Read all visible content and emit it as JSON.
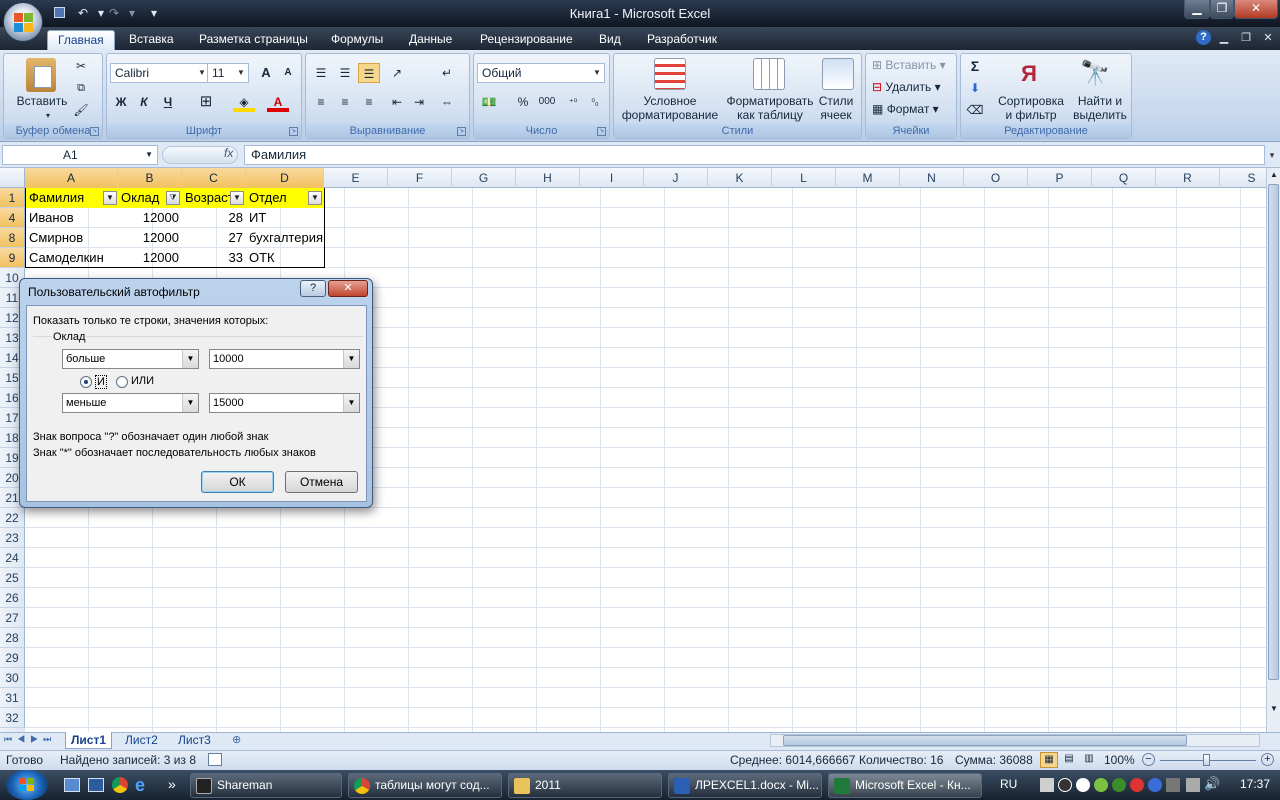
{
  "window": {
    "title": "Книга1 - Microsoft Excel",
    "minimize": "▁",
    "restore": "❐",
    "close": "✕"
  },
  "quick_access": {
    "save": "save-icon",
    "undo": "↶",
    "redo": "↷",
    "more": "▾"
  },
  "ribbon_tabs": [
    "Главная",
    "Вставка",
    "Разметка страницы",
    "Формулы",
    "Данные",
    "Рецензирование",
    "Вид",
    "Разработчик"
  ],
  "ribbon": {
    "clipboard": {
      "label": "Буфер обмена",
      "paste": "Вставить"
    },
    "font": {
      "label": "Шрифт",
      "name": "Calibri",
      "size": "11",
      "bold": "Ж",
      "italic": "К",
      "underline": "Ч",
      "grow": "A",
      "shrink": "A",
      "fontcolor": "A"
    },
    "alignment": {
      "label": "Выравнивание"
    },
    "number": {
      "label": "Число",
      "format": "Общий",
      "percent": "%",
      "thousands": "000"
    },
    "styles": {
      "label": "Стили",
      "cond": "Условное форматирование",
      "astable": "Форматировать как таблицу",
      "cellstyles": "Стили ячеек"
    },
    "cells": {
      "label": "Ячейки",
      "insert": "Вставить",
      "delete": "Удалить",
      "format": "Формат"
    },
    "editing": {
      "label": "Редактирование",
      "sigma": "Σ",
      "sort": "Сортировка и фильтр",
      "find": "Найти и выделить"
    }
  },
  "formula_bar": {
    "name_box": "A1",
    "fx": "fx",
    "value": "Фамилия"
  },
  "columns": [
    "A",
    "B",
    "C",
    "D",
    "E",
    "F",
    "G",
    "H",
    "I",
    "J",
    "K",
    "L",
    "M",
    "N",
    "O",
    "P",
    "Q",
    "R",
    "S"
  ],
  "rows": [
    "1",
    "4",
    "8",
    "9",
    "10",
    "11",
    "12",
    "13",
    "14",
    "15",
    "16",
    "17",
    "18",
    "19",
    "20",
    "21",
    "22",
    "23",
    "24",
    "25",
    "26",
    "27",
    "28",
    "29",
    "30",
    "31",
    "32"
  ],
  "table": {
    "headers": [
      "Фамилия",
      "Оклад",
      "Возраст",
      "Отдел"
    ],
    "data": [
      [
        "Иванов",
        "12000",
        "28",
        "ИТ"
      ],
      [
        "Смирнов",
        "12000",
        "27",
        "бухгалтерия"
      ],
      [
        "Самоделкин",
        "12000",
        "33",
        "ОТК"
      ]
    ]
  },
  "dialog": {
    "title": "Пользовательский автофильтр",
    "help": "?",
    "close": "✕",
    "prompt": "Показать только те строки, значения которых:",
    "field": "Оклад",
    "cond1_op": "больше",
    "cond1_val": "10000",
    "and_label": "И",
    "or_label": "ИЛИ",
    "cond2_op": "меньше",
    "cond2_val": "15000",
    "hint1": "Знак вопроса \"?\" обозначает один любой знак",
    "hint2": "Знак \"*\" обозначает последовательность любых знаков",
    "ok": "ОК",
    "cancel": "Отмена"
  },
  "sheets": [
    "Лист1",
    "Лист2",
    "Лист3"
  ],
  "status": {
    "ready": "Готово",
    "found": "Найдено записей: 3 из 8",
    "average": "Среднее: 6014,666667",
    "count": "Количество: 16",
    "sum": "Сумма: 36088",
    "zoom": "100%"
  },
  "taskbar": {
    "items": [
      "Shareman",
      "таблицы могут сод...",
      "2011",
      "ЛPEXCEL1.docx - Mi...",
      "Microsoft Excel - Кн..."
    ],
    "lang": "RU",
    "time": "17:37"
  }
}
